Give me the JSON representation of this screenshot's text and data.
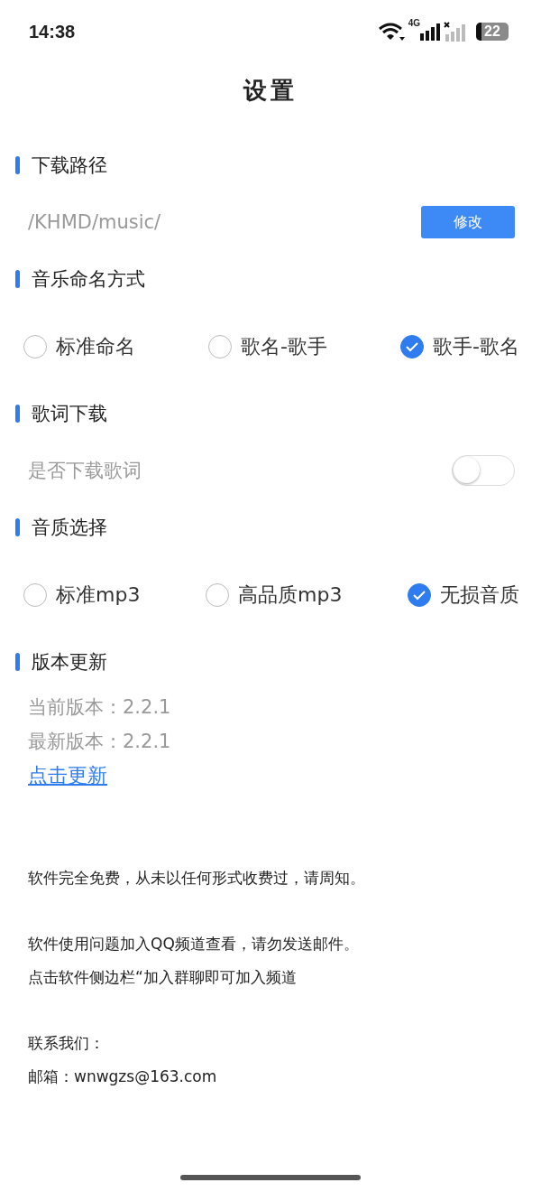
{
  "status_bar": {
    "time": "14:38",
    "network": "4G",
    "battery": "22"
  },
  "title": "设置",
  "sections": [
    {
      "kind": "path",
      "heading": "下载路径",
      "path": "/KHMD/music/",
      "button": "修改"
    },
    {
      "kind": "radio",
      "heading": "音乐命名方式",
      "options": [
        {
          "label": "标准命名",
          "selected": false
        },
        {
          "label": "歌名-歌手",
          "selected": false
        },
        {
          "label": "歌手-歌名",
          "selected": true
        }
      ]
    },
    {
      "kind": "toggle",
      "heading": "歌词下载",
      "label": "是否下载歌词",
      "on": false
    },
    {
      "kind": "radio",
      "heading": "音质选择",
      "options": [
        {
          "label": "标准mp3",
          "selected": false
        },
        {
          "label": "高品质mp3",
          "selected": false
        },
        {
          "label": "无损音质",
          "selected": true
        }
      ]
    },
    {
      "kind": "version",
      "heading": "版本更新",
      "lines": [
        "当前版本：2.2.1",
        "最新版本：2.2.1"
      ],
      "link": "点击更新"
    }
  ],
  "notes": [
    [
      "软件完全免费，从未以任何形式收费过，请周知。"
    ],
    [
      "软件使用问题加入QQ频道查看，请勿发送邮件。",
      "点击软件侧边栏“加入群聊即可加入频道"
    ],
    [
      "联系我们：",
      "邮箱：wnwgzs@163.com"
    ]
  ]
}
